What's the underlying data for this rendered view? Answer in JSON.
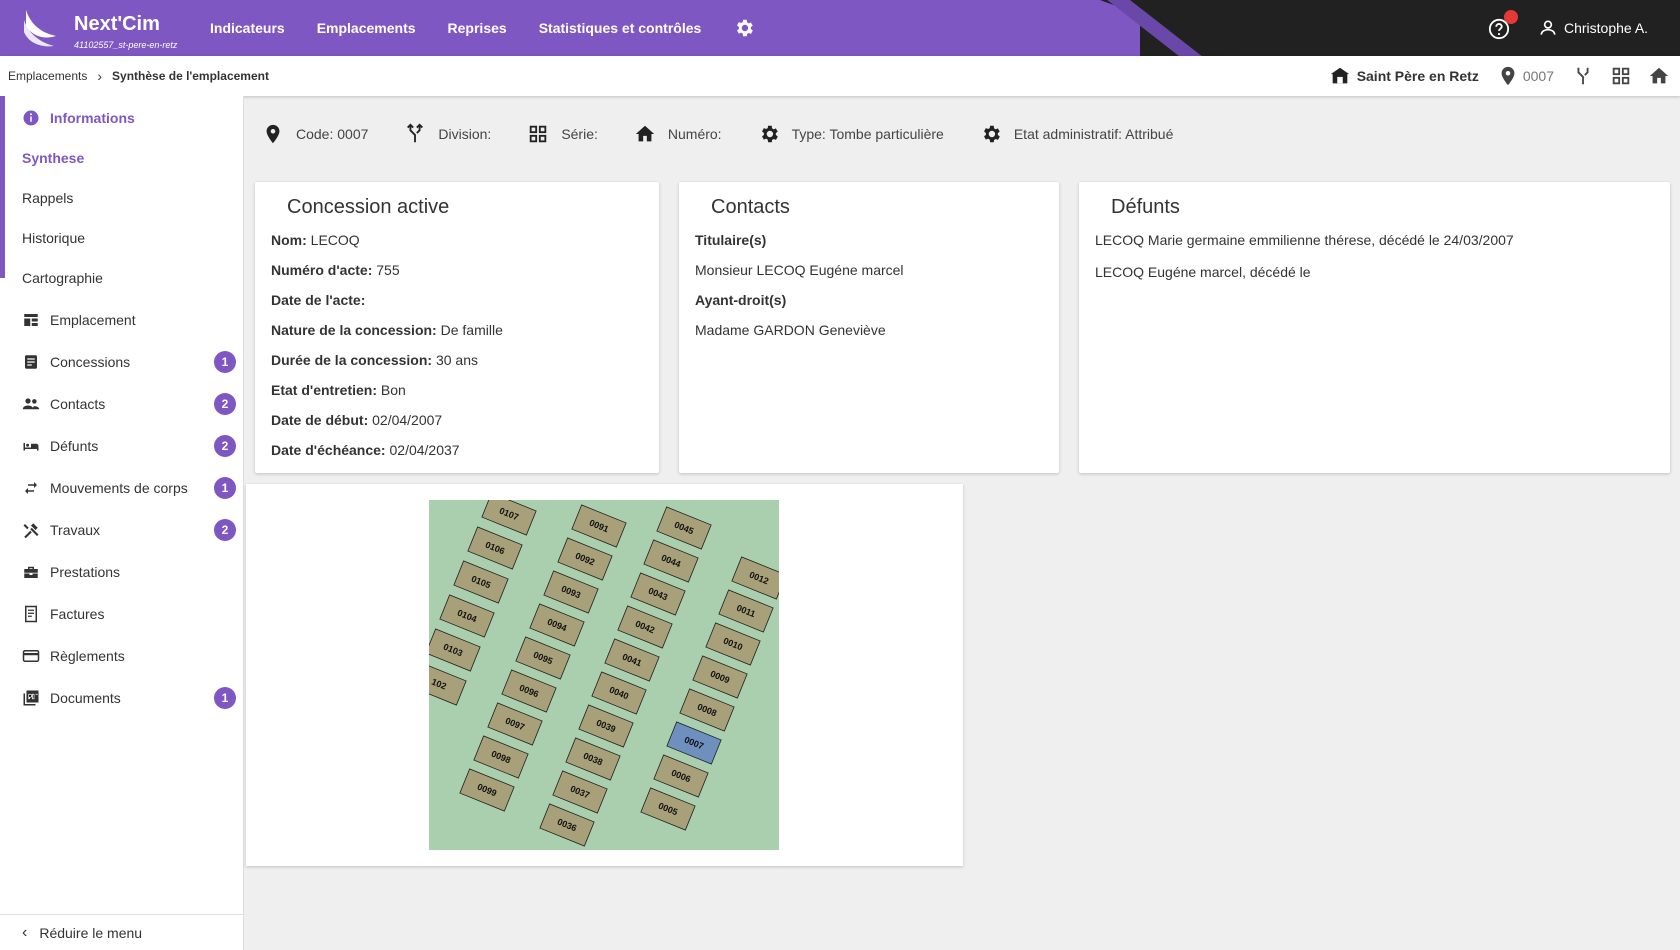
{
  "app": {
    "name": "Next'Cim",
    "subtitle": "41102557_st-pere-en-retz"
  },
  "nav": {
    "items": [
      "Indicateurs",
      "Emplacements",
      "Reprises",
      "Statistiques et contrôles"
    ]
  },
  "user": {
    "name": "Christophe A."
  },
  "breadcrumb": {
    "parent": "Emplacements",
    "separator": "›",
    "current": "Synthèse de l'emplacement"
  },
  "context": {
    "site": "Saint Père en Retz",
    "code": "0007"
  },
  "sidebar": {
    "section": "Informations",
    "items": [
      {
        "label": "Synthese"
      },
      {
        "label": "Rappels"
      },
      {
        "label": "Historique"
      },
      {
        "label": "Cartographie"
      },
      {
        "label": "Emplacement",
        "icon": "dashboard-icon"
      },
      {
        "label": "Concessions",
        "icon": "document-icon",
        "badge": "1"
      },
      {
        "label": "Contacts",
        "icon": "people-icon",
        "badge": "2"
      },
      {
        "label": "Défunts",
        "icon": "bed-icon",
        "badge": "2"
      },
      {
        "label": "Mouvements de corps",
        "icon": "swap-icon",
        "badge": "1"
      },
      {
        "label": "Travaux",
        "icon": "tools-icon",
        "badge": "2"
      },
      {
        "label": "Prestations",
        "icon": "toolbox-icon"
      },
      {
        "label": "Factures",
        "icon": "receipt-icon"
      },
      {
        "label": "Règlements",
        "icon": "credit-card-icon"
      },
      {
        "label": "Documents",
        "icon": "pdf-icon",
        "badge": "1"
      }
    ],
    "collapse_label": "Réduire le menu"
  },
  "info_strip": {
    "code": "Code: 0007",
    "division": "Division:",
    "serie": "Série:",
    "numero": "Numéro:",
    "type": "Type: Tombe particulière",
    "etat": "Etat administratif: Attribué"
  },
  "concession": {
    "title": "Concession active",
    "fields": [
      {
        "label": "Nom:",
        "value": "LECOQ"
      },
      {
        "label": "Numéro d'acte:",
        "value": "755"
      },
      {
        "label": "Date de l'acte:",
        "value": ""
      },
      {
        "label": "Nature de la concession:",
        "value": "De famille"
      },
      {
        "label": "Durée de la concession:",
        "value": "30 ans"
      },
      {
        "label": "Etat d'entretien:",
        "value": "Bon"
      },
      {
        "label": "Date de début:",
        "value": "02/04/2007"
      },
      {
        "label": "Date d'échéance:",
        "value": "02/04/2037"
      }
    ]
  },
  "contacts": {
    "title": "Contacts",
    "titulaire_label": "Titulaire(s)",
    "titulaire": "Monsieur LECOQ Eugéne marcel",
    "ayant_droit_label": "Ayant-droit(s)",
    "ayant_droit": "Madame GARDON Geneviève"
  },
  "defunts": {
    "title": "Défunts",
    "items": [
      "LECOQ Marie germaine emmilienne thérese, décédé le 24/03/2007",
      "LECOQ Eugéne marcel, décédé le"
    ]
  },
  "map": {
    "plots": [
      "0107",
      "0106",
      "0105",
      "0104",
      "0103",
      "102",
      "0091",
      "0092",
      "0093",
      "0094",
      "0095",
      "0096",
      "0097",
      "0098",
      "0099",
      "0045",
      "0044",
      "0043",
      "0042",
      "0041",
      "0040",
      "0039",
      "0038",
      "0037",
      "0036",
      "0012",
      "0011",
      "0010",
      "0009",
      "0008",
      "0007",
      "0006",
      "0005"
    ],
    "highlight": "0007",
    "colors": {
      "ground": "#a9cfae",
      "plot": "#a8a079",
      "highlight": "#6f8fbf"
    }
  },
  "colors": {
    "accent": "#7e57c2",
    "header_dark": "#212121",
    "notification": "#e53935"
  }
}
